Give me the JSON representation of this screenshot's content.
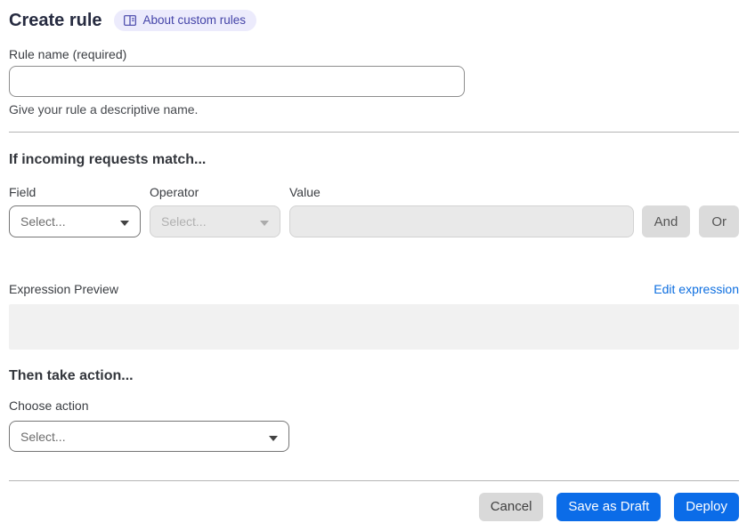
{
  "page": {
    "title": "Create rule",
    "about_link": "About custom rules"
  },
  "rule_name": {
    "label": "Rule name (required)",
    "value": "",
    "helper": "Give your rule a descriptive name."
  },
  "match_section": {
    "heading": "If incoming requests match...",
    "field": {
      "label": "Field",
      "placeholder": "Select..."
    },
    "operator": {
      "label": "Operator",
      "placeholder": "Select..."
    },
    "value": {
      "label": "Value",
      "value": ""
    },
    "and_label": "And",
    "or_label": "Or",
    "expression_preview_label": "Expression Preview",
    "edit_expression_label": "Edit expression",
    "expression_value": ""
  },
  "action_section": {
    "heading": "Then take action...",
    "choose_action_label": "Choose action",
    "placeholder": "Select..."
  },
  "footer": {
    "cancel_label": "Cancel",
    "save_draft_label": "Save as Draft",
    "deploy_label": "Deploy"
  },
  "colors": {
    "primary": "#0b6ce8",
    "link": "#0e6fe0",
    "badge-bg": "#ecebfc",
    "badge-text": "#4444a8",
    "disabled-bg": "#e9e9e9",
    "chip-bg": "#dbdbdb",
    "preview-bg": "#f1f1f1",
    "divider": "#b5b5b5"
  }
}
